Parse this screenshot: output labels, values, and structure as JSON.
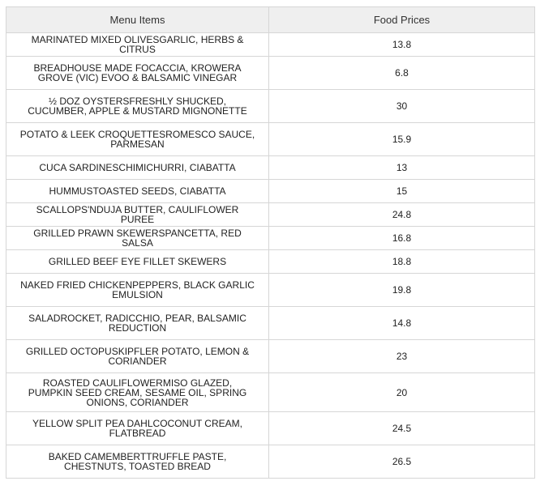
{
  "table": {
    "headers": {
      "item": "Menu Items",
      "price": "Food Prices"
    },
    "rows": [
      {
        "item": "MARINATED MIXED OLIVESGARLIC, HERBS & CITRUS",
        "price": "13.8",
        "size": "h1"
      },
      {
        "item": "BREADHOUSE MADE FOCACCIA, KROWERA GROVE (VIC) EVOO & BALSAMIC VINEGAR",
        "price": "6.8",
        "size": "h2"
      },
      {
        "item": "½ DOZ OYSTERSFRESHLY SHUCKED, CUCUMBER, APPLE & MUSTARD MIGNONETTE",
        "price": "30",
        "size": "h2"
      },
      {
        "item": "POTATO & LEEK CROQUETTESROMESCO SAUCE, PARMESAN",
        "price": "15.9",
        "size": "h2"
      },
      {
        "item": "CUCA SARDINESCHIMICHURRI, CIABATTA",
        "price": "13",
        "size": "h1"
      },
      {
        "item": "HUMMUSTOASTED SEEDS, CIABATTA",
        "price": "15",
        "size": "h1"
      },
      {
        "item": "SCALLOPS'NDUJA BUTTER, CAULIFLOWER PUREE",
        "price": "24.8",
        "size": "h1"
      },
      {
        "item": "GRILLED PRAWN SKEWERSPANCETTA, RED SALSA",
        "price": "16.8",
        "size": "h1"
      },
      {
        "item": "GRILLED BEEF EYE FILLET SKEWERS",
        "price": "18.8",
        "size": "h1"
      },
      {
        "item": "NAKED FRIED CHICKENPEPPERS, BLACK GARLIC EMULSION",
        "price": "19.8",
        "size": "h2"
      },
      {
        "item": "SALADROCKET, RADICCHIO, PEAR, BALSAMIC REDUCTION",
        "price": "14.8",
        "size": "h2"
      },
      {
        "item": "GRILLED OCTOPUSKIPFLER POTATO, LEMON & CORIANDER",
        "price": "23",
        "size": "h2"
      },
      {
        "item": "ROASTED CAULIFLOWERMISO GLAZED, PUMPKIN SEED CREAM, SESAME OIL, SPRING ONIONS, CORIANDER",
        "price": "20",
        "size": "h3"
      },
      {
        "item": "YELLOW SPLIT PEA DAHLCOCONUT CREAM, FLATBREAD",
        "price": "24.5",
        "size": "h2"
      },
      {
        "item": "BAKED CAMEMBERTTRUFFLE PASTE, CHESTNUTS, TOASTED BREAD",
        "price": "26.5",
        "size": "h2"
      }
    ]
  }
}
